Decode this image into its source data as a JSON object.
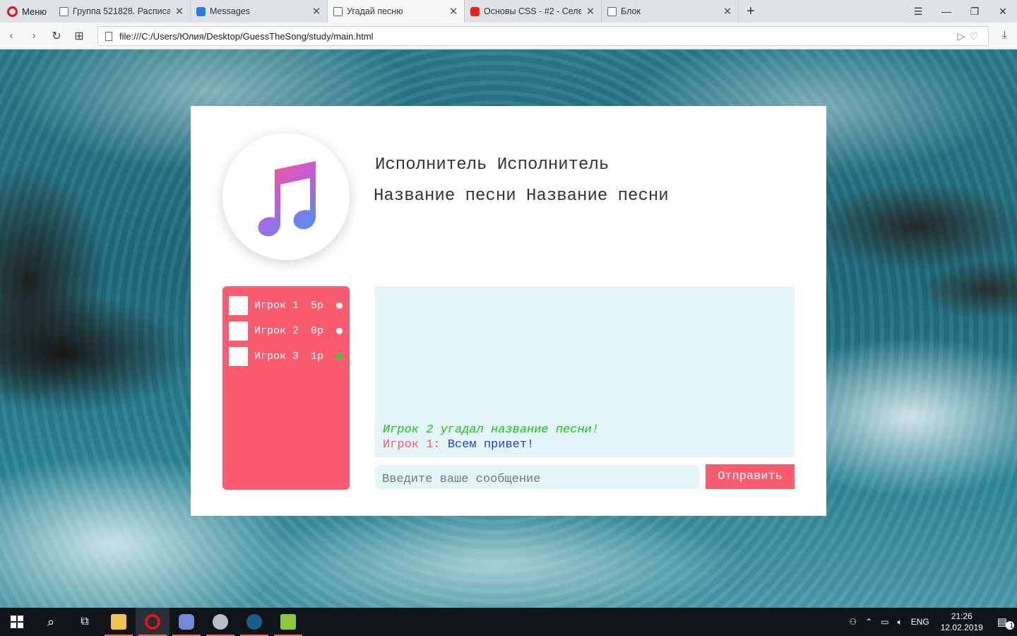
{
  "browser": {
    "menu_label": "Меню",
    "tabs": [
      {
        "label": "Группа 521828. Расписан",
        "icon": "document-icon"
      },
      {
        "label": "Messages",
        "icon": "messages-icon"
      },
      {
        "label": "Угадай песню",
        "icon": "document-icon"
      },
      {
        "label": "Основы CSS - #2 - Селект",
        "icon": "youtube-icon"
      },
      {
        "label": "Блок",
        "icon": "document-icon"
      }
    ],
    "active_tab_index": 2,
    "url": "file:///C:/Users/Юлия/Desktop/GuessTheSong/study/main.html"
  },
  "app": {
    "artist": "Исполнитель Исполнитель",
    "song_title": "Название песни Название песни",
    "players": [
      {
        "name": "Игрок 1",
        "score": "5р",
        "status": "idle"
      },
      {
        "name": "Игрок 2",
        "score": "0р",
        "status": "idle"
      },
      {
        "name": "Игрок 3",
        "score": "1р",
        "status": "online"
      }
    ],
    "chat": {
      "system_message": "Игрок 2 угадал название песни!",
      "message_author": "Игрок 1:",
      "message_text": "Всем привет!"
    },
    "input_placeholder": "Введите ваше сообщение",
    "send_label": "Отправить",
    "colors": {
      "accent": "#fa5b6e",
      "chat_bg": "#e3f5f7",
      "system_text": "#1bc51b",
      "message_text": "#2b3fd4"
    }
  },
  "taskbar": {
    "language": "ENG",
    "time": "21:26",
    "date": "12.02.2019",
    "notification_count": "1"
  }
}
